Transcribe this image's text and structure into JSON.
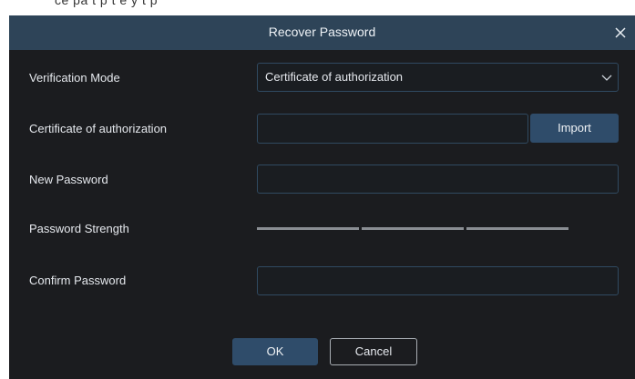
{
  "background": {
    "partial_text": "ce pa    t p          t        e  y   t  p"
  },
  "dialog": {
    "title": "Recover Password",
    "close_icon": "close-icon"
  },
  "form": {
    "verification_mode": {
      "label": "Verification Mode",
      "selected": "Certificate of authorization"
    },
    "certificate": {
      "label": "Certificate of authorization",
      "value": "",
      "import_label": "Import"
    },
    "new_password": {
      "label": "New Password",
      "value": ""
    },
    "password_strength": {
      "label": "Password Strength",
      "level": 0,
      "max_level": 3
    },
    "confirm_password": {
      "label": "Confirm Password",
      "value": ""
    }
  },
  "buttons": {
    "ok": "OK",
    "cancel": "Cancel"
  },
  "colors": {
    "titlebar": "#2e4458",
    "dialog_bg": "#1b1c1f",
    "primary_button": "#2f4c6a",
    "field_border": "#304a61",
    "strength_empty": "#8a8e93"
  }
}
